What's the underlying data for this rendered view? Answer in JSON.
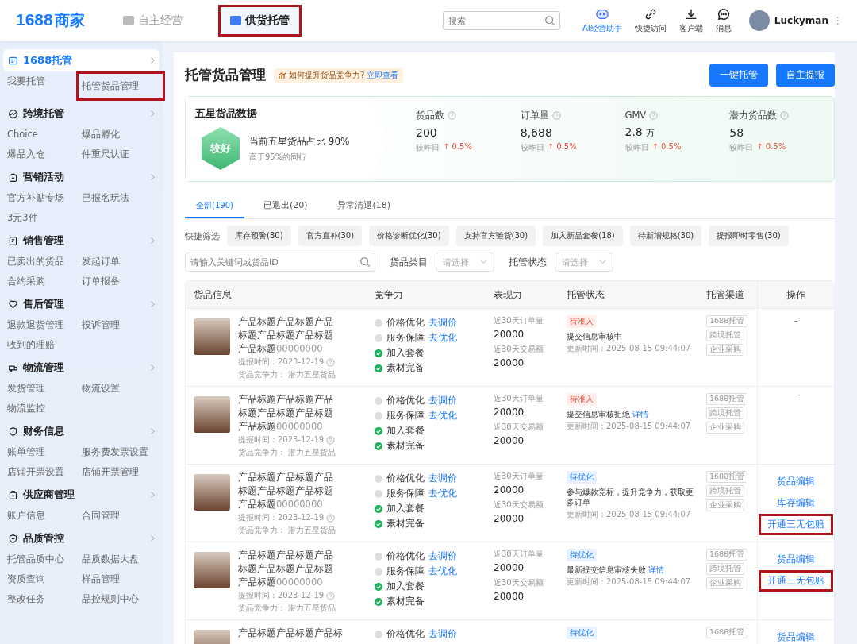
{
  "topbar": {
    "logo": {
      "number": "1688",
      "text": "商家"
    },
    "tabs": [
      {
        "label": "自主经营",
        "selected": false,
        "highlighted": false
      },
      {
        "label": "供货托管",
        "selected": true,
        "highlighted": true
      }
    ],
    "search": {
      "placeholder": "搜索"
    },
    "tools": [
      {
        "kind": "ai",
        "label": "AI经营助手"
      },
      {
        "kind": "link",
        "label": "快捷访问"
      },
      {
        "kind": "download",
        "label": "客户端"
      },
      {
        "kind": "message",
        "label": "消息"
      }
    ],
    "user": {
      "name": "Luckyman",
      "menu": "⋮"
    }
  },
  "sidebar": {
    "groups": [
      {
        "kind": "hosting",
        "title": "1688托管",
        "selected": true,
        "items": [
          {
            "label": "我要托管",
            "highlighted": false
          },
          {
            "label": "托管货品管理",
            "highlighted": true
          }
        ]
      },
      {
        "kind": "globe",
        "title": "跨境托管",
        "selected": false,
        "items": [
          {
            "label": "Choice",
            "highlighted": false
          },
          {
            "label": "爆品孵化",
            "highlighted": false
          },
          {
            "label": "爆品入仓",
            "highlighted": false
          },
          {
            "label": "件重尺认证",
            "highlighted": false
          }
        ]
      },
      {
        "kind": "bag",
        "title": "营销活动",
        "selected": false,
        "items": [
          {
            "label": "官方补贴专场",
            "highlighted": false
          },
          {
            "label": "已报名玩法",
            "highlighted": false
          },
          {
            "label": "3元3件",
            "highlighted": false
          }
        ]
      },
      {
        "kind": "doc",
        "title": "销售管理",
        "selected": false,
        "items": [
          {
            "label": "已卖出的货品",
            "highlighted": false
          },
          {
            "label": "发起订单",
            "highlighted": false
          },
          {
            "label": "合约采购",
            "highlighted": false
          },
          {
            "label": "订单报备",
            "highlighted": false
          }
        ]
      },
      {
        "kind": "heart",
        "title": "售后管理",
        "selected": false,
        "items": [
          {
            "label": "退款退货管理",
            "highlighted": false
          },
          {
            "label": "投诉管理",
            "highlighted": false
          },
          {
            "label": "收到的理赔",
            "highlighted": false
          }
        ]
      },
      {
        "kind": "truck",
        "title": "物流管理",
        "selected": false,
        "items": [
          {
            "label": "发货管理",
            "highlighted": false
          },
          {
            "label": "物流设置",
            "highlighted": false
          },
          {
            "label": "物流监控",
            "highlighted": false
          }
        ]
      },
      {
        "kind": "shield",
        "title": "财务信息",
        "selected": false,
        "items": [
          {
            "label": "账单管理",
            "highlighted": false
          },
          {
            "label": "服务费发票设置",
            "highlighted": false
          },
          {
            "label": "店铺开票设置",
            "highlighted": false
          },
          {
            "label": "店铺开票管理",
            "highlighted": false
          }
        ]
      },
      {
        "kind": "box",
        "title": "供应商管理",
        "selected": false,
        "items": [
          {
            "label": "账户信息",
            "highlighted": false
          },
          {
            "label": "合同管理",
            "highlighted": false
          }
        ]
      },
      {
        "kind": "badge",
        "title": "品质管控",
        "selected": false,
        "items": [
          {
            "label": "托管品质中心",
            "highlighted": false
          },
          {
            "label": "品质数据大盘",
            "highlighted": false
          },
          {
            "label": "资质查询",
            "highlighted": false
          },
          {
            "label": "样品管理",
            "highlighted": false
          },
          {
            "label": "整改任务",
            "highlighted": false
          },
          {
            "label": "品控规则中心",
            "highlighted": false
          }
        ]
      }
    ]
  },
  "header": {
    "title": "托管货品管理",
    "tip": {
      "text": "如何提升货品竞争力?",
      "link": "立即查看"
    },
    "buttons": [
      "一键托管",
      "自主提报"
    ]
  },
  "stats": {
    "title": "五星货品数据",
    "rating": "较好",
    "summary": "当前五星货品占比 90%",
    "compare": "高于95%的同行",
    "metrics": [
      {
        "label": "货品数",
        "value": "200",
        "prefix": "较昨日",
        "change": "↑ 0.5%"
      },
      {
        "label": "订单量",
        "value": "8,688",
        "prefix": "较昨日",
        "change": "↑ 0.5%"
      },
      {
        "label": "GMV",
        "value": "2.8",
        "unit": "万",
        "prefix": "较昨日",
        "change": "↑ 0.5%"
      },
      {
        "label": "潜力货品数",
        "value": "58",
        "prefix": "较昨日",
        "change": "↑ 0.5%"
      }
    ]
  },
  "tabs": [
    {
      "label": "全部(190)",
      "selected": true
    },
    {
      "label": "已退出(20)",
      "selected": false
    },
    {
      "label": "异常清退(18)",
      "selected": false
    }
  ],
  "quick_filters": {
    "label": "快捷筛选",
    "chips": [
      "库存预警(30)",
      "官方直补(30)",
      "价格诊断优化(30)",
      "支持官方验货(30)",
      "加入新品套餐(18)",
      "待新增规格(30)",
      "提报即时零售(30)"
    ]
  },
  "filters": {
    "search": {
      "placeholder": "请输入关键词或货品ID"
    },
    "selects": [
      {
        "label": "货品类目",
        "placeholder": "请选择"
      },
      {
        "label": "托管状态",
        "placeholder": "请选择"
      }
    ]
  },
  "table": {
    "columns": [
      "货品信息",
      "竞争力",
      "表现力",
      "托管状态",
      "托管渠道",
      "操作"
    ],
    "rows": [
      {
        "title": "产品标题产品标题产品标题产品标题产品标题产品标题",
        "id": "00000000",
        "report_time": "提报时间：2023-12-19",
        "competitiveness": "货品竞争力：  潜力五星货品",
        "checks": [
          {
            "label": "价格优化",
            "done": false,
            "action": "去调价"
          },
          {
            "label": "服务保障",
            "done": false,
            "action": "去优化"
          },
          {
            "label": "加入套餐",
            "done": true
          },
          {
            "label": "素材完备",
            "done": true
          }
        ],
        "performance": [
          {
            "label": "近30天订单量",
            "value": "20000"
          },
          {
            "label": "近30天交易额",
            "value": "20000"
          }
        ],
        "status": {
          "kind": "pending",
          "badge": "待准入",
          "text": "提交信息审核中",
          "updated": "更新时间：2025-08-15 09:44:07"
        },
        "channels": [
          "1688托管",
          "跨境托管",
          "企业采购"
        ],
        "actions": [
          {
            "kind": "none",
            "label": "–"
          }
        ]
      },
      {
        "title": "产品标题产品标题产品标题产品标题产品标题产品标题",
        "id": "00000000",
        "report_time": "提报时间：2023-12-19",
        "competitiveness": "货品竞争力：  潜力五星货品",
        "checks": [
          {
            "label": "价格优化",
            "done": false,
            "action": "去调价"
          },
          {
            "label": "服务保障",
            "done": false,
            "action": "去优化"
          },
          {
            "label": "加入套餐",
            "done": true
          },
          {
            "label": "素材完备",
            "done": true
          }
        ],
        "performance": [
          {
            "label": "近30天订单量",
            "value": "20000"
          },
          {
            "label": "近30天交易额",
            "value": "20000"
          }
        ],
        "status": {
          "kind": "pending",
          "badge": "待准入",
          "text": "提交信息审核拒绝",
          "link": "详情",
          "updated": "更新时间：2025-08-15 09:44:07"
        },
        "channels": [
          "1688托管",
          "跨境托管",
          "企业采购"
        ],
        "actions": [
          {
            "kind": "none",
            "label": "–"
          }
        ]
      },
      {
        "title": "产品标题产品标题产品标题产品标题产品标题产品标题",
        "id": "00000000",
        "report_time": "提报时间：2023-12-19",
        "competitiveness": "货品竞争力：  潜力五星货品",
        "checks": [
          {
            "label": "价格优化",
            "done": false,
            "action": "去调价"
          },
          {
            "label": "服务保障",
            "done": false,
            "action": "去优化"
          },
          {
            "label": "加入套餐",
            "done": true
          },
          {
            "label": "素材完备",
            "done": true
          }
        ],
        "performance": [
          {
            "label": "近30天订单量",
            "value": "20000"
          },
          {
            "label": "近30天交易额",
            "value": "20000"
          }
        ],
        "status": {
          "kind": "optimize",
          "badge": "待优化",
          "text": "参与爆款竞标，提升竞争力，获取更多订单",
          "updated": "更新时间：2025-08-15 09:44:07"
        },
        "channels": [
          "1688托管",
          "跨境托管",
          "企业采购"
        ],
        "actions": [
          {
            "kind": "link",
            "label": "货品编辑",
            "highlighted": false
          },
          {
            "kind": "link",
            "label": "库存编辑",
            "highlighted": false
          },
          {
            "kind": "link",
            "label": "开通三无包赔",
            "highlighted": true
          }
        ]
      },
      {
        "title": "产品标题产品标题产品标题产品标题产品标题产品标题",
        "id": "00000000",
        "report_time": "提报时间：2023-12-19",
        "competitiveness": "货品竞争力：  潜力五星货品",
        "checks": [
          {
            "label": "价格优化",
            "done": false,
            "action": "去调价"
          },
          {
            "label": "服务保障",
            "done": false,
            "action": "去优化"
          },
          {
            "label": "加入套餐",
            "done": true
          },
          {
            "label": "素材完备",
            "done": true
          }
        ],
        "performance": [
          {
            "label": "近30天订单量",
            "value": "20000"
          },
          {
            "label": "近30天交易额",
            "value": "20000"
          }
        ],
        "status": {
          "kind": "optimize",
          "badge": "待优化",
          "text": "最新提交信息审核失败",
          "link": "详情",
          "updated": "更新时间：2025-08-15 09:44:07"
        },
        "channels": [
          "1688托管",
          "跨境托管",
          "企业采购"
        ],
        "actions": [
          {
            "kind": "link",
            "label": "货品编辑",
            "highlighted": false
          },
          {
            "kind": "link",
            "label": "开通三无包赔",
            "highlighted": true
          }
        ]
      },
      {
        "title": "产品标题产品标题产品标",
        "checks": [
          {
            "label": "价格优化",
            "done": false,
            "action": "去调价"
          }
        ],
        "status": {
          "kind": "optimize",
          "badge": "待优化"
        },
        "channels": [
          "1688托管"
        ],
        "actions": [
          {
            "kind": "link",
            "label": "货品编辑",
            "highlighted": false
          }
        ]
      }
    ]
  }
}
